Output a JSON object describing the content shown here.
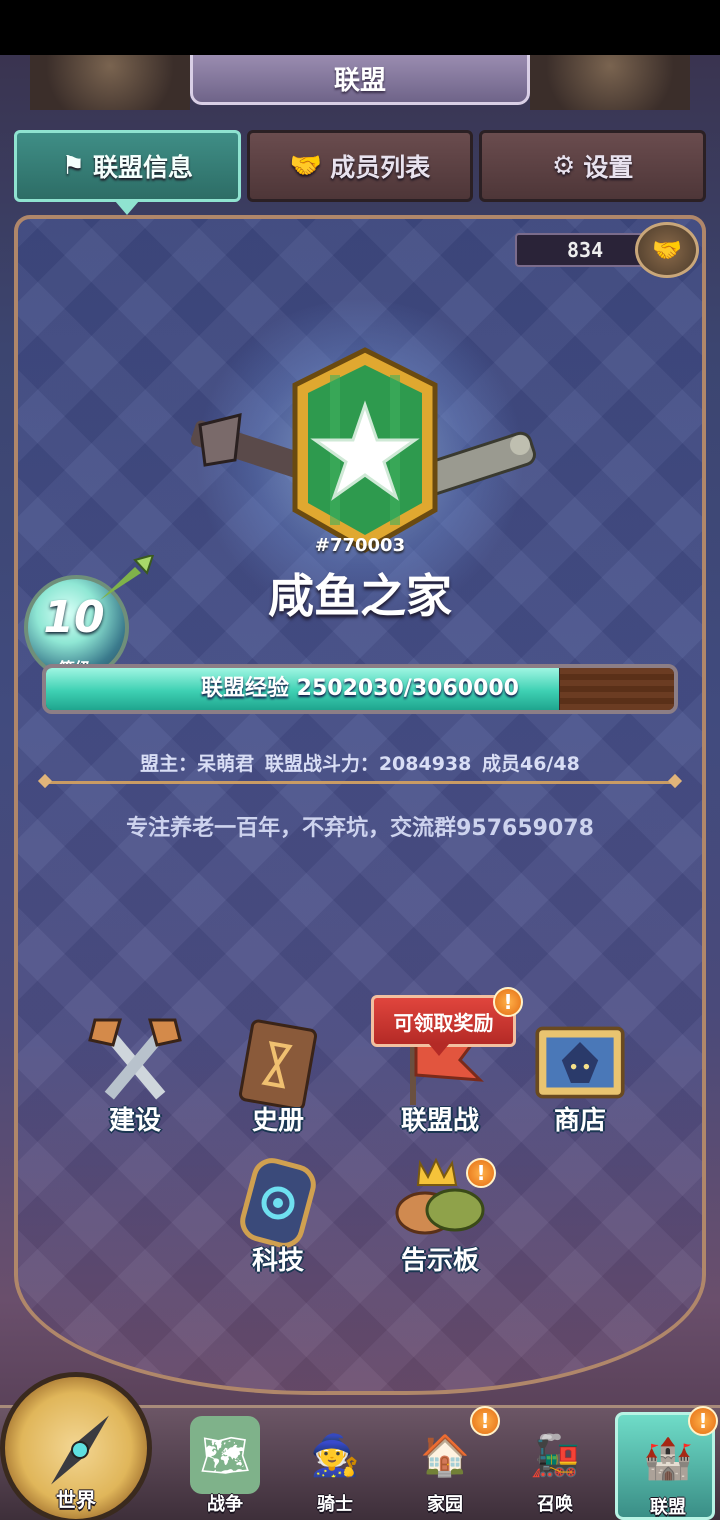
{
  "header": {
    "title": "联盟"
  },
  "tabs": [
    {
      "label": "联盟信息",
      "icon": "flag-icon",
      "active": true
    },
    {
      "label": "成员列表",
      "icon": "handshake-icon",
      "active": false
    },
    {
      "label": "设置",
      "icon": "gear-icon",
      "active": false
    }
  ],
  "counter": {
    "value": "834"
  },
  "alliance": {
    "id": "#770003",
    "name": "咸鱼之家",
    "level": "10",
    "level_label": "等级",
    "xp_text": "联盟经验 2502030/3060000",
    "xp_current": 2502030,
    "xp_max": 3060000,
    "meta": {
      "leader": "盟主：呆萌君",
      "power": "联盟战斗力：2084938",
      "members": "成员46/48"
    },
    "motto": "专注养老一百年，不弃坑，交流群957659078"
  },
  "features": {
    "build": {
      "label": "建设",
      "icon": "hammer-crossed-icon"
    },
    "history": {
      "label": "史册",
      "icon": "book-icon"
    },
    "war": {
      "label": "联盟战",
      "icon": "war-flag-icon",
      "alert": "!"
    },
    "shop": {
      "label": "商店",
      "icon": "shop-icon"
    },
    "tech": {
      "label": "科技",
      "icon": "tech-gear-icon"
    },
    "board": {
      "label": "告示板",
      "icon": "notice-board-icon",
      "alert": "!"
    }
  },
  "reward_pill": "可领取奖励",
  "reward_alert": "!",
  "nav": {
    "world": {
      "label": "世界",
      "icon": "compass-icon"
    },
    "war": {
      "label": "战争",
      "icon": "map-icon"
    },
    "knight": {
      "label": "骑士",
      "icon": "knight-icon"
    },
    "home": {
      "label": "家园",
      "icon": "house-icon",
      "alert": "!"
    },
    "summon": {
      "label": "召唤",
      "icon": "train-icon"
    },
    "alliance": {
      "label": "联盟",
      "icon": "alliance-icon",
      "alert": "!"
    }
  },
  "colors": {
    "accent": "#3ed0b3",
    "alert": "#e36b12",
    "tab_active": "#3f8e86",
    "tab_inactive": "#5a3f42"
  }
}
